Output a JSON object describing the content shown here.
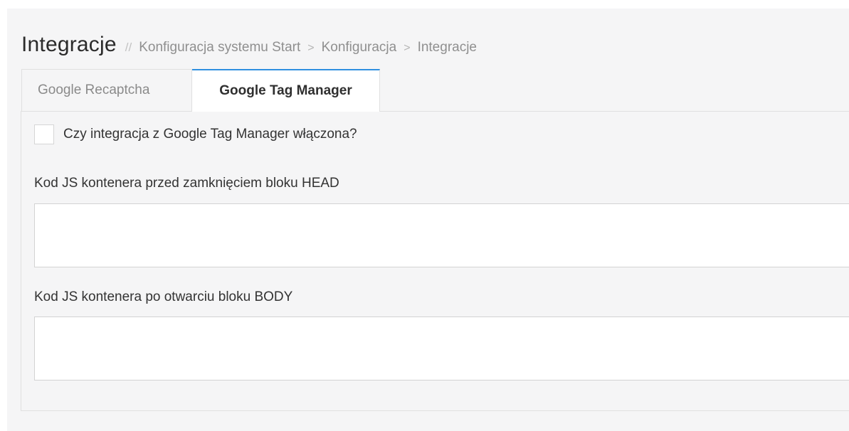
{
  "header": {
    "title": "Integracje",
    "separator": "//",
    "breadcrumb": [
      "Konfiguracja systemu Start",
      "Konfiguracja",
      "Integracje"
    ],
    "breadcrumb_separator": ">"
  },
  "tabs": [
    {
      "label": "Google Recaptcha",
      "active": false
    },
    {
      "label": "Google Tag Manager",
      "active": true
    }
  ],
  "form": {
    "enabled_checkbox": {
      "label": "Czy integracja z Google Tag Manager włączona?",
      "checked": false
    },
    "head_code": {
      "label": "Kod JS kontenera przed zamknięciem bloku HEAD",
      "value": ""
    },
    "body_code": {
      "label": "Kod JS kontenera po otwarciu bloku BODY",
      "value": ""
    }
  },
  "colors": {
    "active_tab_accent": "#2f8fe0",
    "panel_background": "#f5f5f6",
    "border": "#e0e0e0"
  }
}
